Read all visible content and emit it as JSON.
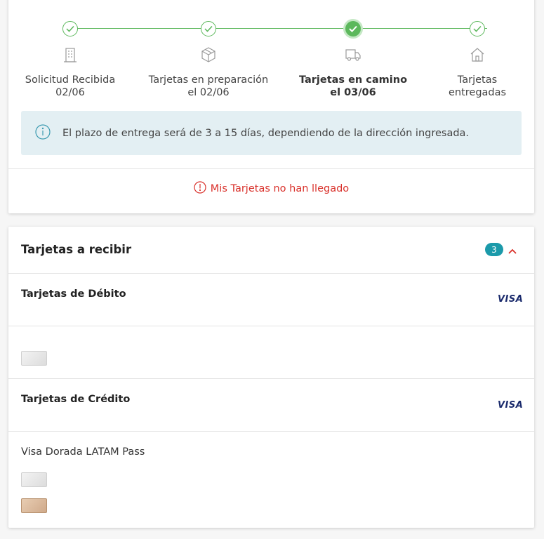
{
  "tracking": {
    "steps": [
      {
        "label_line1": "Solicitud Recibida",
        "label_line2": "02/06",
        "icon": "building-icon",
        "bold": false
      },
      {
        "label_line1": "Tarjetas en preparación",
        "label_line2": "el 02/06",
        "icon": "box-icon",
        "bold": false
      },
      {
        "label_line1": "Tarjetas en camino",
        "label_line2": "el 03/06",
        "icon": "truck-icon",
        "bold": true
      },
      {
        "label_line1": "Tarjetas",
        "label_line2": "entregadas",
        "icon": "house-icon",
        "bold": false
      }
    ],
    "current_step": 3,
    "info_message": "El plazo de entrega será de 3 a 15 días, dependiendo de la dirección ingresada.",
    "alert_link": "Mis Tarjetas no han llegado"
  },
  "cards_section": {
    "title": "Tarjetas a recibir",
    "count": "3",
    "debit": {
      "title": "Tarjetas de Débito",
      "brand": "VISA"
    },
    "credit": {
      "title": "Tarjetas de Crédito",
      "brand": "VISA",
      "card_name": "Visa Dorada LATAM Pass"
    }
  },
  "colors": {
    "success": "#5cb85c",
    "info_bg": "#e3eff3",
    "alert": "#d9312b",
    "badge": "#1b9aaa",
    "visa": "#1a2a6c"
  }
}
